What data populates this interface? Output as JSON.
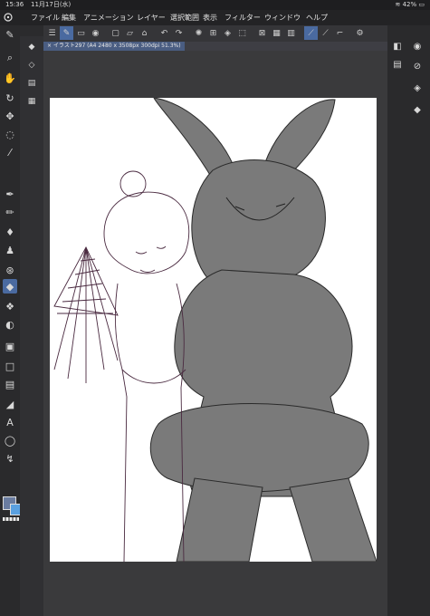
{
  "status_bar": {
    "time": "15:36",
    "date": "11月17日(水)",
    "battery": "42%"
  },
  "menu": [
    "ファイル",
    "編集",
    "アニメーション",
    "レイヤー",
    "選択範囲",
    "表示",
    "フィルター",
    "ウィンドウ",
    "ヘルプ"
  ],
  "tab": {
    "label": "× イラスト297 (A4 2480 x 3508px 300dpi 51.3%)"
  },
  "icons": {
    "left_tools": [
      "pen-icon",
      "search-icon",
      "hand-icon",
      "rotate-view-icon",
      "move-icon",
      "lasso-icon",
      "eyedropper-icon",
      "pen-icon",
      "pencil-icon",
      "brush-icon",
      "airbrush-icon",
      "decoration-icon",
      "eraser-icon",
      "blend-icon",
      "fill-icon",
      "gradient-icon",
      "figure-icon",
      "frame-icon",
      "ruler-icon",
      "text-icon",
      "balloon-icon",
      "correct-line-icon"
    ],
    "toolbar": [
      "menu-icon",
      "pen-sync-icon",
      "selection-icon",
      "tool-icon",
      "open-folder-icon",
      "new-icon",
      "save-icon",
      "undo-icon",
      "redo-icon",
      "loading-icon",
      "crop-icon",
      "fill-icon",
      "transform-icon",
      "clear-icon",
      "grid-icon",
      "layer-icon",
      "ruler-icon",
      "smoothing-icon",
      "stabilizer-icon",
      "settings-icon"
    ]
  },
  "colors": {
    "main": "#6a7ca0",
    "sub": "#5aa0e0"
  }
}
